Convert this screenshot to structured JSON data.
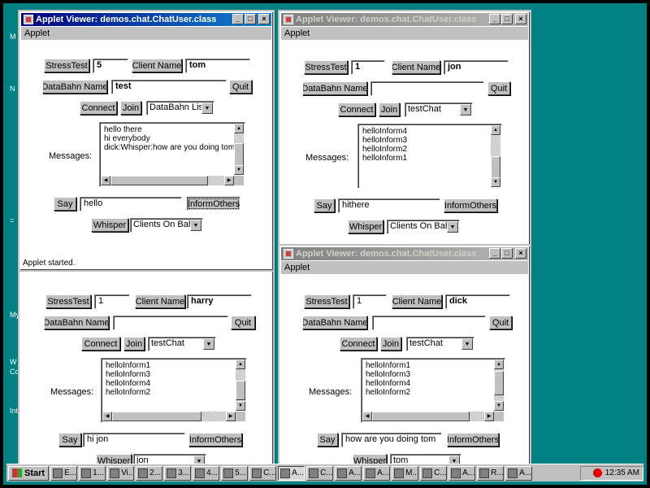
{
  "desktop": {
    "icon_labels": [
      "M",
      "N",
      "=",
      "My",
      "W",
      "Co",
      "Int"
    ]
  },
  "windows": [
    {
      "id": "tom",
      "title": "Applet Viewer: demos.chat.ChatUser.class",
      "menu": "Applet",
      "active": true,
      "stress_label": "StressTest",
      "stress_value": "5",
      "client_label": "Client Name",
      "client_value": "tom",
      "databahn_label": "DataBahn Name",
      "databahn_value": "test",
      "quit_label": "Quit",
      "connect_label": "Connect",
      "join_label": "Join",
      "databahn_choice": "DataBahn List",
      "messages_label": "Messages:",
      "messages": [
        "hello there",
        "hi everybody",
        "",
        "dick:Whisper:how are you doing tom"
      ],
      "say_label": "Say",
      "say_value": "hello",
      "inform_label": "InformOthers",
      "whisper_label": "Whisper",
      "whisper_choice": "Clients On Bahn",
      "status": "Applet started."
    },
    {
      "id": "jon",
      "title": "Applet Viewer: demos.chat.ChatUser.class",
      "menu": "Applet",
      "active": false,
      "stress_label": "StressTest",
      "stress_value": "1",
      "client_label": "Client Name",
      "client_value": "jon",
      "databahn_label": "DataBahn Name",
      "databahn_value": "",
      "quit_label": "Quit",
      "connect_label": "Connect",
      "join_label": "Join",
      "databahn_choice": "testChat",
      "messages_label": "Messages:",
      "messages": [
        "helloInform4",
        "helloInform3",
        "helloInform2",
        "helloInform1"
      ],
      "say_label": "Say",
      "say_value": "hithere",
      "inform_label": "InformOthers",
      "whisper_label": "Whisper",
      "whisper_choice": "Clients On Bahn"
    },
    {
      "id": "harry",
      "stress_label": "StressTest",
      "stress_value": "1",
      "client_label": "Client Name",
      "client_value": "harry",
      "databahn_label": "DataBahn Name",
      "databahn_value": "",
      "quit_label": "Quit",
      "connect_label": "Connect",
      "join_label": "Join",
      "databahn_choice": "testChat",
      "messages_label": "Messages:",
      "messages": [
        "helloInform1",
        "helloInform3",
        "helloInform4",
        "helloInform2"
      ],
      "say_label": "Say",
      "say_value": "hi jon",
      "inform_label": "InformOthers",
      "whisper_label": "Whisper",
      "whisper_choice": "jon"
    },
    {
      "id": "dick",
      "title": "Applet Viewer: demos.chat.ChatUser.class",
      "menu": "Applet",
      "active": false,
      "stress_label": "StressTest",
      "stress_value": "1",
      "client_label": "Client Name",
      "client_value": "dick",
      "databahn_label": "DataBahn Name",
      "databahn_value": "",
      "quit_label": "Quit",
      "connect_label": "Connect",
      "join_label": "Join",
      "databahn_choice": "testChat",
      "messages_label": "Messages:",
      "messages": [
        "helloInform1",
        "helloInform3",
        "helloInform4",
        "helloInform2"
      ],
      "say_label": "Say",
      "say_value": "how are you doing tom",
      "inform_label": "InformOthers",
      "whisper_label": "Whisper",
      "whisper_choice": "tom"
    }
  ],
  "taskbar": {
    "start_label": "Start",
    "tasks": [
      "E...",
      "1...",
      "Vi...",
      "2...",
      "3...",
      "4...",
      "5...",
      "C...",
      "A...",
      "C...",
      "A...",
      "A...",
      "M...",
      "C...",
      "A...",
      "R...",
      "A..."
    ],
    "active_task_index": 8,
    "clock": "12:35 AM"
  }
}
